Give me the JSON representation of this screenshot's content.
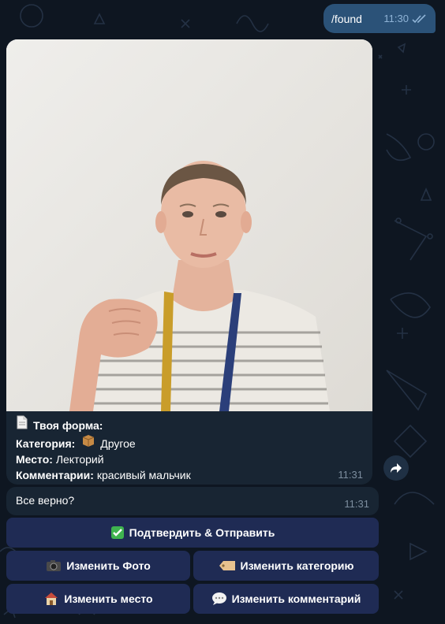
{
  "outgoing": {
    "text": "/found",
    "time": "11:30"
  },
  "photo_message": {
    "form_title": "Твоя форма:",
    "category_label": "Категория:",
    "category_value": "Другое",
    "place_label": "Место:",
    "place_value": "Лекторий",
    "comment_label": "Комментарии:",
    "comment_value": "красивый мальчик",
    "time": "11:31"
  },
  "confirm_message": {
    "text": "Все верно?",
    "time": "11:31"
  },
  "keyboard": {
    "confirm": "Подтвердить & Отправить",
    "change_photo": "Изменить Фото",
    "change_category": "Изменить категорию",
    "change_place": "Изменить место",
    "change_comment": "Изменить комментарий"
  },
  "colors": {
    "background": "#0e1621",
    "outgoing_bubble": "#2b5278",
    "incoming_bubble": "#182533",
    "keyboard_button": "#1f2b54"
  },
  "icons": [
    "document-icon",
    "package-icon",
    "check-icon",
    "camera-icon",
    "tag-icon",
    "house-icon",
    "speech-bubble-icon",
    "forward-icon",
    "double-check-icon"
  ]
}
